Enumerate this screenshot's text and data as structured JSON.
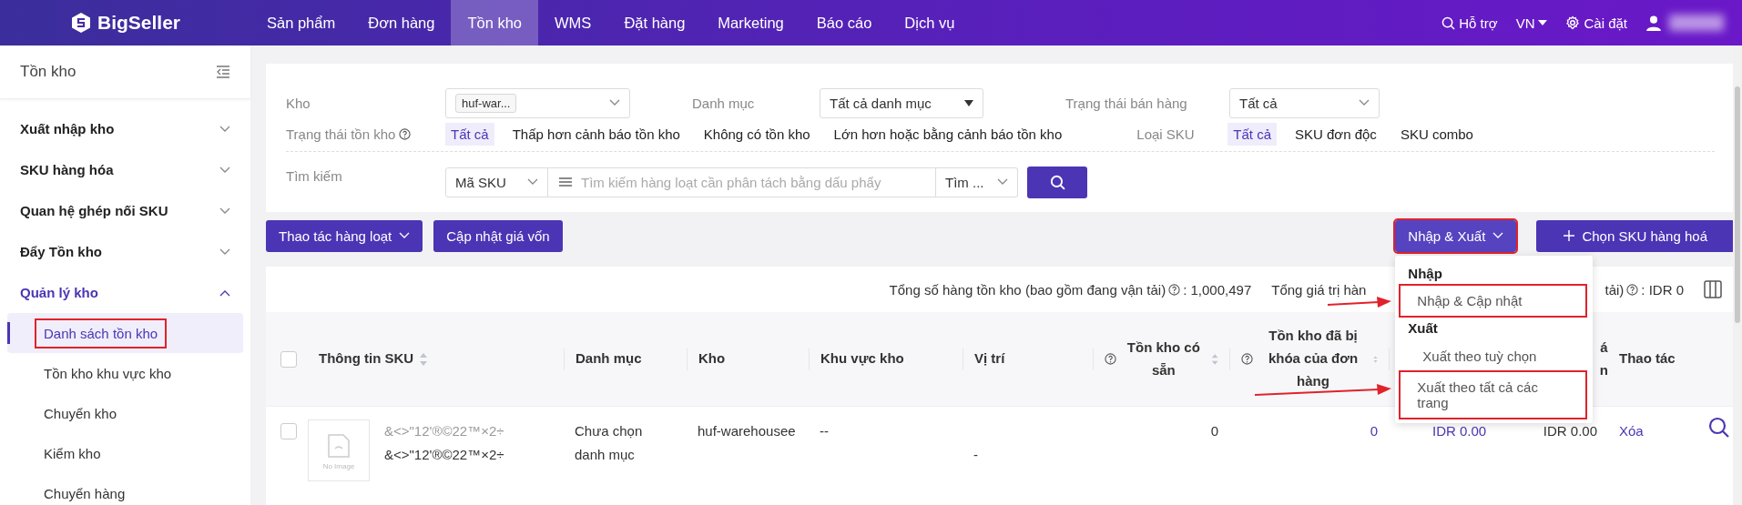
{
  "topbar": {
    "logo": "BigSeller",
    "nav": [
      {
        "label": "Sản phẩm",
        "selected": false
      },
      {
        "label": "Đơn hàng",
        "selected": false
      },
      {
        "label": "Tồn kho",
        "selected": true
      },
      {
        "label": "WMS",
        "selected": false
      },
      {
        "label": "Đặt hàng",
        "selected": false
      },
      {
        "label": "Marketing",
        "selected": false
      },
      {
        "label": "Báo cáo",
        "selected": false
      },
      {
        "label": "Dịch vụ",
        "selected": false
      }
    ],
    "support": "Hỗ trợ",
    "language": "VN",
    "settings": "Cài đặt"
  },
  "sidebar": {
    "title": "Tồn kho",
    "groups": [
      {
        "label": "Xuất nhập kho",
        "expanded": false
      },
      {
        "label": "SKU hàng hóa",
        "expanded": false
      },
      {
        "label": "Quan hệ ghép nối SKU",
        "expanded": false
      },
      {
        "label": "Đẩy Tồn kho",
        "expanded": false
      },
      {
        "label": "Quản lý kho",
        "expanded": true,
        "children": [
          {
            "label": "Danh sách tồn kho",
            "selected": true,
            "highlighted": true
          },
          {
            "label": "Tồn kho khu vực kho",
            "selected": false,
            "highlighted": false
          },
          {
            "label": "Chuyển kho",
            "selected": false,
            "highlighted": false
          },
          {
            "label": "Kiểm kho",
            "selected": false,
            "highlighted": false
          },
          {
            "label": "Chuyển hàng",
            "selected": false,
            "highlighted": false
          }
        ]
      }
    ]
  },
  "filters": {
    "warehouse": {
      "label": "Kho",
      "tag": "huf-war..."
    },
    "category": {
      "label": "Danh mục",
      "value": "Tất cả danh mục"
    },
    "sale_status": {
      "label": "Trạng thái bán hàng",
      "value": "Tất cả"
    },
    "stock_status": {
      "label": "Trạng thái tồn kho",
      "options": [
        {
          "label": "Tất cả",
          "selected": true
        },
        {
          "label": "Thấp hơn cảnh báo tồn kho",
          "selected": false
        },
        {
          "label": "Không có tồn kho",
          "selected": false
        },
        {
          "label": "Lớn hơn hoặc bằng cảnh báo tồn kho",
          "selected": false
        }
      ]
    },
    "sku_type": {
      "label": "Loại SKU",
      "options": [
        {
          "label": "Tất cả",
          "selected": true
        },
        {
          "label": "SKU đơn độc",
          "selected": false
        },
        {
          "label": "SKU combo",
          "selected": false
        }
      ]
    },
    "search": {
      "label": "Tìm kiếm",
      "field": "Mã SKU",
      "placeholder": "Tìm kiếm hàng loạt cần phân tách bằng dấu phẩy",
      "mode": "Tìm ..."
    }
  },
  "toolbar": {
    "bulk": "Thao tác hàng loạt",
    "update_cost": "Cập nhật giá vốn",
    "import_export": {
      "label": "Nhập & Xuất",
      "highlighted": true
    },
    "add": "Chọn SKU hàng hoá"
  },
  "menu": {
    "sections": [
      {
        "title": "Nhập",
        "items": [
          {
            "label": "Nhập & Cập nhật",
            "highlighted": true,
            "arrow": true
          }
        ]
      },
      {
        "title": "Xuất",
        "items": [
          {
            "label": "Xuất theo tuỳ chọn",
            "highlighted": false,
            "arrow": false
          },
          {
            "label": "Xuất theo tất cả các trang",
            "highlighted": true,
            "arrow": true
          }
        ]
      }
    ]
  },
  "stats": {
    "total_qty": "Tổng số hàng tồn kho (bao gồm đang vận tải)",
    "total_qty_value": ": 1,000,497",
    "total_value_start": "Tổng giá trị hàn",
    "total_value_end": "tải)",
    "total_value_value": ": IDR 0"
  },
  "table": {
    "columns": [
      {
        "label": "Thông tin SKU",
        "sortable": true
      },
      {
        "label": "Danh mục"
      },
      {
        "label": "Kho"
      },
      {
        "label": "Khu vực kho"
      },
      {
        "label": "Vị trí"
      },
      {
        "label": "Tồn kho có sẵn",
        "sortable": true,
        "help": true
      },
      {
        "label": "Tồn kho đã bị khóa của đơn hàng",
        "sortable": true,
        "help": true
      },
      {
        "label": "á\nn"
      },
      {
        "label": "Thao tác"
      }
    ],
    "header_checked": false,
    "rows": [
      {
        "checked": false,
        "image_text": "No Image",
        "sku_lines": [
          "&<>\"12'®©22™×2÷",
          "&<>\"12'®©22™×2÷"
        ],
        "category": "Chưa chọn danh mục",
        "warehouse": "huf-warehousee",
        "zone": "--",
        "location": "-",
        "available": "0",
        "locked": "0",
        "column_8": "IDR 0.00",
        "column_9": "IDR 0.00",
        "action": "Xóa"
      }
    ]
  }
}
